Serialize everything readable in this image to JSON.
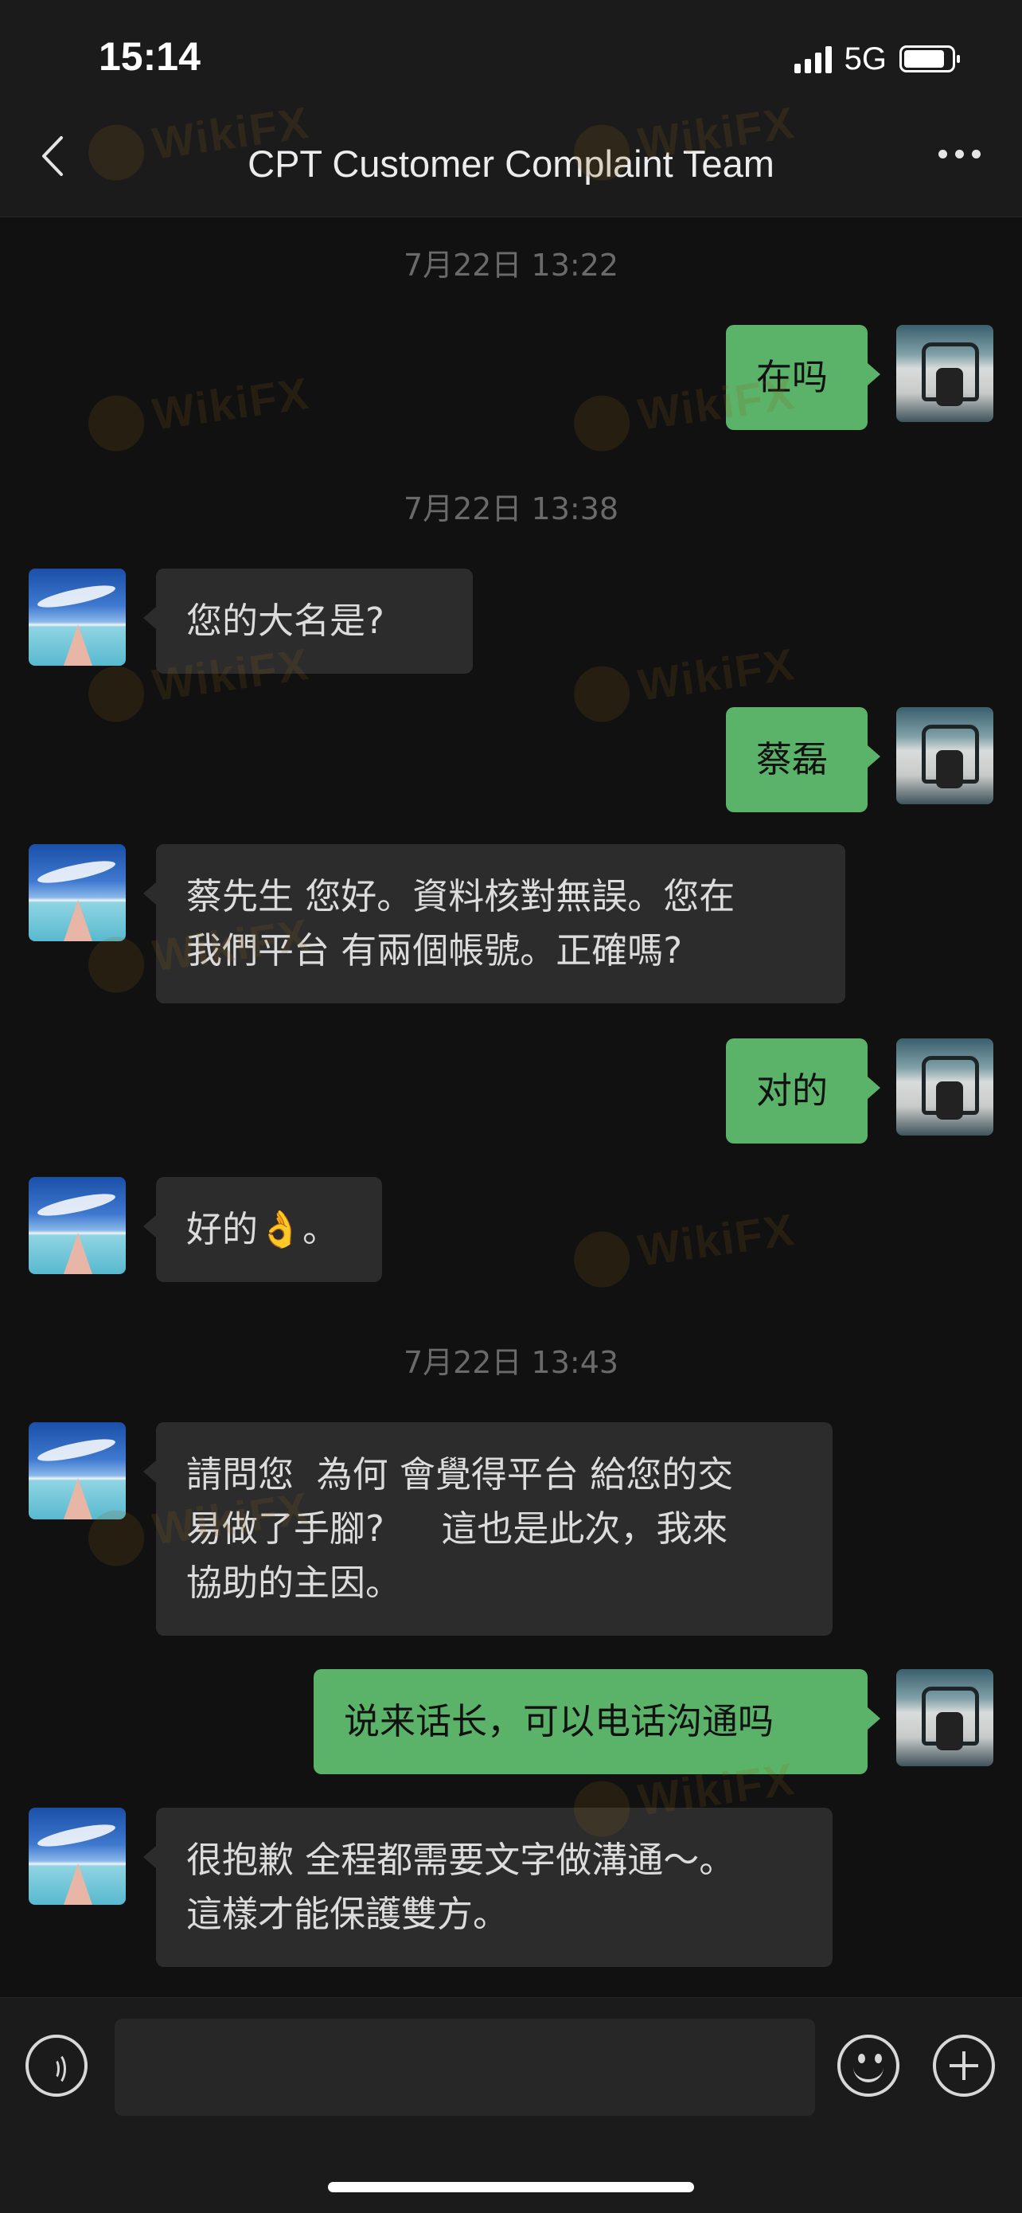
{
  "status_bar": {
    "time": "15:14",
    "network": "5G"
  },
  "header": {
    "title": "CPT Customer Complaint Team"
  },
  "watermark_text": "WikiFX",
  "messages": [
    {
      "type": "timestamp",
      "text": "7月22日 13:22"
    },
    {
      "type": "out",
      "text": "在吗"
    },
    {
      "type": "timestamp",
      "text": "7月22日 13:38"
    },
    {
      "type": "in",
      "text": "您的大名是?"
    },
    {
      "type": "out",
      "text": "蔡磊"
    },
    {
      "type": "in",
      "text": "蔡先生 您好。資料核對無誤。您在\n我們平台 有兩個帳號。正確嗎?"
    },
    {
      "type": "out",
      "text": "对的"
    },
    {
      "type": "in",
      "text": "好的👌。"
    },
    {
      "type": "timestamp",
      "text": "7月22日 13:43"
    },
    {
      "type": "in",
      "text": "請問您  為何 會覺得平台 給您的交\n易做了手腳?     這也是此次，我來\n協助的主因。"
    },
    {
      "type": "out",
      "text": "说来话长，可以电话沟通吗"
    },
    {
      "type": "in",
      "text": "很抱歉 全程都需要文字做溝通～。\n這樣才能保護雙方。"
    }
  ],
  "input": {
    "value": ""
  },
  "colors": {
    "accent_green": "#5bb36a",
    "incoming_bubble": "#2c2c2c",
    "background": "#111111"
  }
}
